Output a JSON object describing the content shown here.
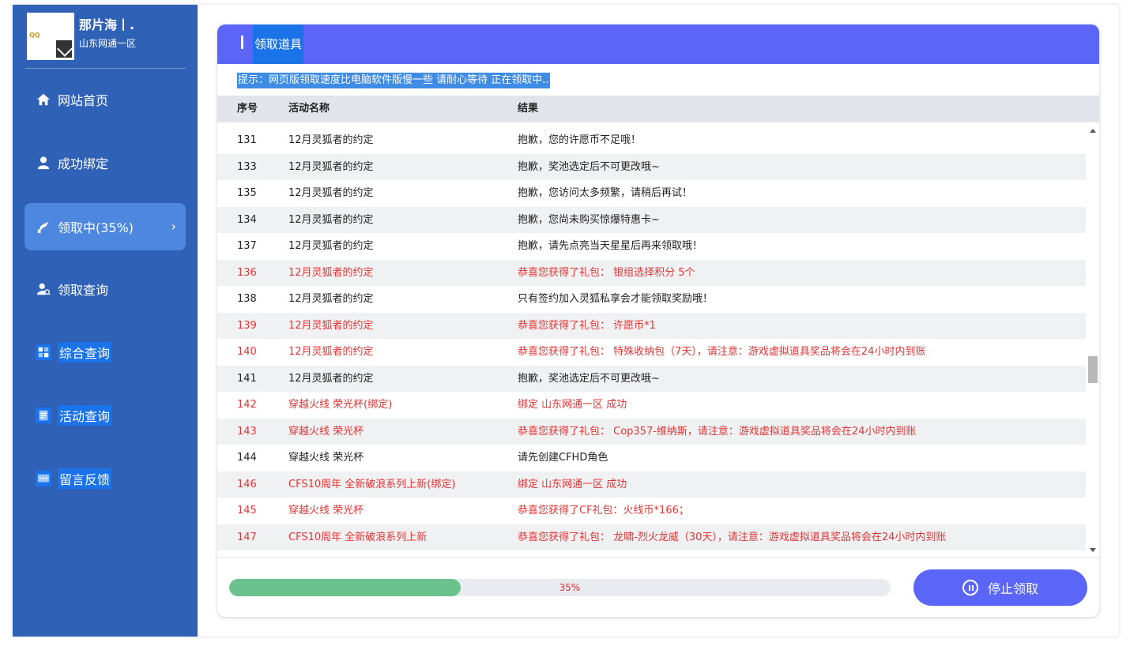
{
  "profile": {
    "avatar_logo": "QQ",
    "name": "那片海丨.",
    "server": "山东网通一区"
  },
  "sidebar": {
    "items": [
      {
        "label": "网站首页",
        "icon": "home-icon",
        "active": false
      },
      {
        "label": "成功绑定",
        "icon": "user-icon",
        "active": false
      },
      {
        "label": "领取中(35%)",
        "icon": "gift-icon",
        "active": true
      },
      {
        "label": "领取查询",
        "icon": "user-search-icon",
        "active": false
      },
      {
        "label": "综合查询",
        "icon": "grid-icon",
        "active": false
      },
      {
        "label": "活动查询",
        "icon": "document-icon",
        "active": false
      },
      {
        "label": "留言反馈",
        "icon": "message-icon",
        "active": false
      }
    ],
    "active_chevron": "›"
  },
  "panel": {
    "title": "领取道具",
    "notice": "提示：网页版领取速度比电脑软件版慢一些 请耐心等待 正在领取中..",
    "columns": [
      "序号",
      "活动名称",
      "结果"
    ],
    "rows": [
      {
        "id": "131",
        "name": "12月灵狐者的约定",
        "result": "抱歉，您的许愿币不足哦！",
        "win": false
      },
      {
        "id": "133",
        "name": "12月灵狐者的约定",
        "result": "抱歉，奖池选定后不可更改哦~",
        "win": false
      },
      {
        "id": "135",
        "name": "12月灵狐者的约定",
        "result": "抱歉，您访问太多频繁，请稍后再试！",
        "win": false
      },
      {
        "id": "134",
        "name": "12月灵狐者的约定",
        "result": "抱歉，您尚未购买惊爆特惠卡~",
        "win": false
      },
      {
        "id": "137",
        "name": "12月灵狐者的约定",
        "result": "抱歉，请先点亮当天星星后再来领取哦！",
        "win": false
      },
      {
        "id": "136",
        "name": "12月灵狐者的约定",
        "result": "恭喜您获得了礼包： 银组选择积分 5个",
        "win": true
      },
      {
        "id": "138",
        "name": "12月灵狐者的约定",
        "result": "只有签约加入灵狐私享会才能领取奖励哦！",
        "win": false
      },
      {
        "id": "139",
        "name": "12月灵狐者的约定",
        "result": "恭喜您获得了礼包： 许愿币*1",
        "win": true
      },
      {
        "id": "140",
        "name": "12月灵狐者的约定",
        "result": "恭喜您获得了礼包： 特殊收纳包（7天），请注意：游戏虚拟道具奖品将会在24小时内到账",
        "win": true
      },
      {
        "id": "141",
        "name": "12月灵狐者的约定",
        "result": "抱歉，奖池选定后不可更改哦~",
        "win": false
      },
      {
        "id": "142",
        "name": "穿越火线 荣光杯(绑定)",
        "result": "绑定 山东网通一区 成功",
        "win": true
      },
      {
        "id": "143",
        "name": "穿越火线 荣光杯",
        "result": "恭喜您获得了礼包： Cop357-维纳斯，请注意：游戏虚拟道具奖品将会在24小时内到账",
        "win": true
      },
      {
        "id": "144",
        "name": "穿越火线 荣光杯",
        "result": "请先创建CFHD角色",
        "win": false
      },
      {
        "id": "146",
        "name": "CFS10周年 全新破浪系列上新(绑定)",
        "result": "绑定 山东网通一区 成功",
        "win": true
      },
      {
        "id": "145",
        "name": "穿越火线 荣光杯",
        "result": "恭喜您获得了CF礼包：火线币*166；",
        "win": true
      },
      {
        "id": "147",
        "name": "CFS10周年 全新破浪系列上新",
        "result": "恭喜您获得了礼包： 龙啸-烈火龙威（30天），请注意：游戏虚拟道具奖品将会在24小时内到账",
        "win": true
      }
    ],
    "progress_percent": 35,
    "progress_label": "35%",
    "stop_button": "停止领取"
  },
  "colors": {
    "sidebar_bg": "#2f62b6",
    "accent": "#5b65f7",
    "success_text": "#e33434",
    "progress_fill": "#6bc28c"
  }
}
